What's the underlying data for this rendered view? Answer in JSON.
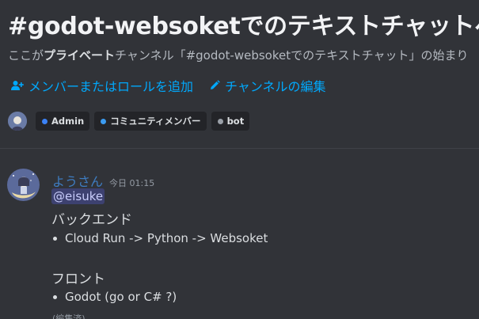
{
  "header": {
    "title": "#godot-websoketでのテキストチャットへ",
    "description_prefix": "ここが",
    "description_bold": "プライベート",
    "description_suffix": "チャンネル「#godot-websoketでのテキストチャット」の始まり"
  },
  "actions": {
    "add_members_label": "メンバーまたはロールを追加",
    "add_members_icon": "add-user-icon",
    "edit_channel_label": "チャンネルの編集",
    "edit_channel_icon": "pencil-icon"
  },
  "roles": [
    {
      "label": "Admin",
      "color": "#3b82f6"
    },
    {
      "label": "コミュニティメンバー",
      "color": "#3b9bf0"
    },
    {
      "label": "bot",
      "color": "#9aa0a8"
    }
  ],
  "message": {
    "username": "ようさん",
    "username_color": "#3e7dc2",
    "timestamp": "今日 01:15",
    "mention": "@eisuke",
    "line1": "バックエンド",
    "bullet1": "Cloud Run -> Python -> Websoket",
    "line2": "フロント",
    "bullet2": "Godot (go or C# ?)",
    "edited": "(編集済)"
  }
}
